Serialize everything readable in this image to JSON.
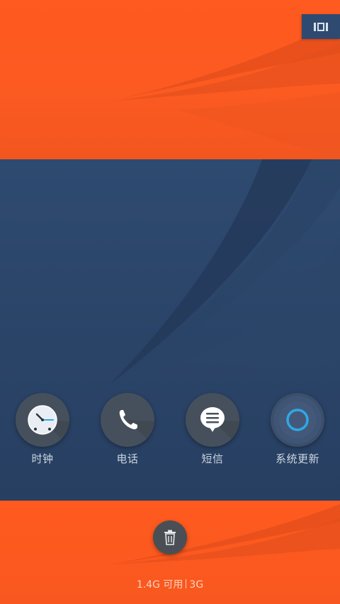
{
  "recent_apps": [
    {
      "label": "时钟",
      "icon": "clock-icon"
    },
    {
      "label": "电话",
      "icon": "phone-icon"
    },
    {
      "label": "短信",
      "icon": "message-icon"
    },
    {
      "label": "系统更新",
      "icon": "system-update-icon"
    }
  ],
  "controls": {
    "multiwindow_icon": "multiwindow-icon",
    "clear_all_icon": "trash-icon"
  },
  "memory": {
    "available": "1.4G 可用",
    "total": "3G"
  },
  "colors": {
    "orange": "#ff5a1f",
    "navy": "#2f4a70",
    "icon_bg": "#46505c",
    "update_ring": "#2ea8e6",
    "clock_accent": "#2ea8e6"
  }
}
